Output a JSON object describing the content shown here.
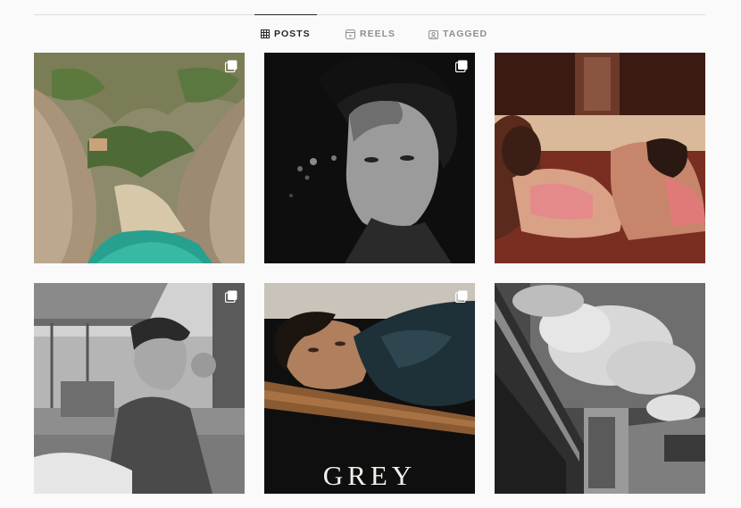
{
  "tabs": [
    {
      "label": "POSTS",
      "icon": "grid-icon",
      "active": true
    },
    {
      "label": "REELS",
      "icon": "reels-icon",
      "active": false
    },
    {
      "label": "TAGGED",
      "icon": "tagged-icon",
      "active": false
    }
  ],
  "posts": [
    {
      "subject": "coastal-cove-photo",
      "multiple": true
    },
    {
      "subject": "portrait-man-dark",
      "multiple": true
    },
    {
      "subject": "couple-on-sofa",
      "multiple": false
    },
    {
      "subject": "man-on-terrace",
      "multiple": true
    },
    {
      "subject": "grey-magazine-cover",
      "multiple": true,
      "caption": "GREY"
    },
    {
      "subject": "architecture-clouds",
      "multiple": false
    }
  ],
  "colors": {
    "background": "#fafafa",
    "active_tab": "#262626",
    "inactive_tab": "#8e8e8e",
    "divider": "#dbdbdb"
  }
}
